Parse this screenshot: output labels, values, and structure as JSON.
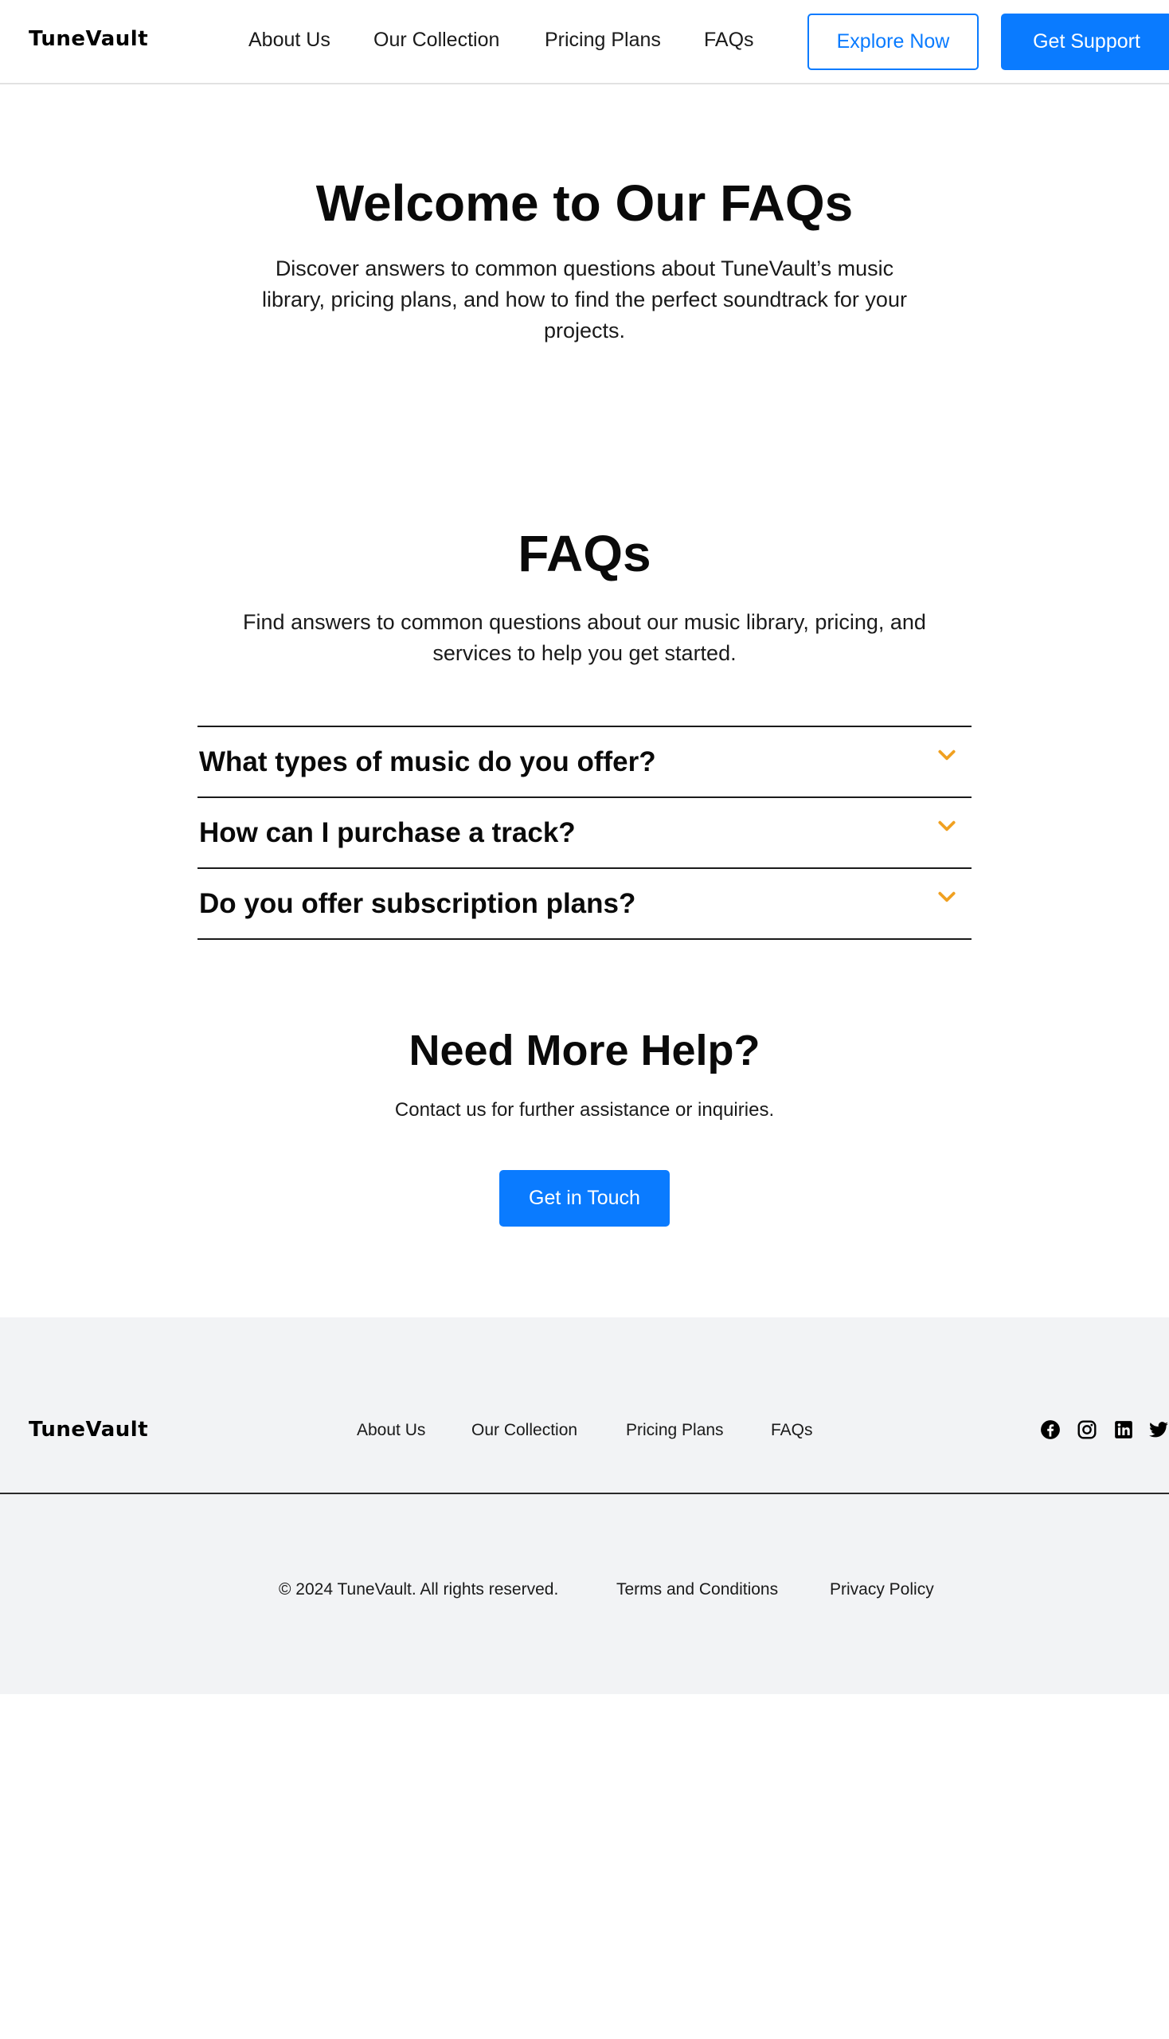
{
  "header": {
    "logo": "TuneVault",
    "nav": [
      "About Us",
      "Our Collection",
      "Pricing Plans",
      "FAQs"
    ],
    "explore_label": "Explore Now",
    "support_label": "Get Support"
  },
  "hero": {
    "title": "Welcome to Our FAQs",
    "subtitle": "Discover answers to common questions about TuneVault’s music library, pricing plans, and how to find the perfect soundtrack for your projects."
  },
  "faq": {
    "title": "FAQs",
    "subtitle": "Find answers to common questions about our music library, pricing, and services to help you get started.",
    "items": [
      {
        "question": "What types of music do you offer?"
      },
      {
        "question": "How can I purchase a track?"
      },
      {
        "question": "Do you offer subscription plans?"
      }
    ]
  },
  "help": {
    "title": "Need More Help?",
    "subtitle": "Contact us for further assistance or inquiries.",
    "button_label": "Get in Touch"
  },
  "footer": {
    "logo": "TuneVault",
    "links": [
      "About Us",
      "Our Collection",
      "Pricing Plans",
      "FAQs"
    ],
    "social": [
      "facebook-icon",
      "instagram-icon",
      "linkedin-icon",
      "twitter-icon"
    ],
    "copyright": "© 2024 TuneVault. All rights reserved.",
    "terms": "Terms and Conditions",
    "privacy": "Privacy Policy"
  },
  "colors": {
    "accent": "#0a7bff",
    "chevron": "#f0a020",
    "footer_bg": "#f2f3f5"
  }
}
